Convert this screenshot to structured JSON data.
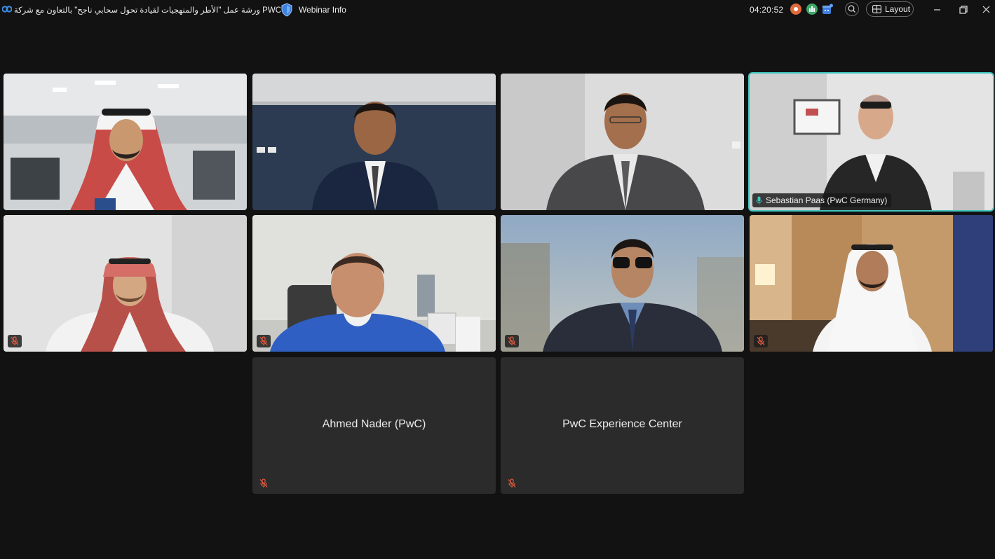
{
  "window": {
    "meeting_title": "ورشة عمل \"الأطر والمنهجيات لقيادة تحول سحابي ناجح\" بالتعاون مع شركة PWC",
    "webinar_info_label": "Webinar Info",
    "elapsed_time": "04:20:52",
    "layout_label": "Layout"
  },
  "colors": {
    "background": "#121212",
    "active_speaker_border": "#3fc6bf",
    "mute_icon": "#e05a3f",
    "unmuted_mic": "#3fc6bf"
  },
  "participants": [
    {
      "id": "p1",
      "muted": false,
      "video": true
    },
    {
      "id": "p2",
      "muted": false,
      "video": true
    },
    {
      "id": "p3",
      "muted": false,
      "video": true
    },
    {
      "id": "p4",
      "name": "Sebastian Paas (PwC Germany)",
      "muted": false,
      "video": true,
      "active_speaker": true
    },
    {
      "id": "p5",
      "muted": true,
      "video": true
    },
    {
      "id": "p6",
      "muted": true,
      "video": true
    },
    {
      "id": "p7",
      "muted": true,
      "video": true
    },
    {
      "id": "p8",
      "muted": true,
      "video": true
    },
    {
      "id": "p9",
      "name": "Ahmed Nader (PwC)",
      "muted": true,
      "video": false
    },
    {
      "id": "p10",
      "name": "PwC Experience Center",
      "muted": true,
      "video": false
    }
  ]
}
